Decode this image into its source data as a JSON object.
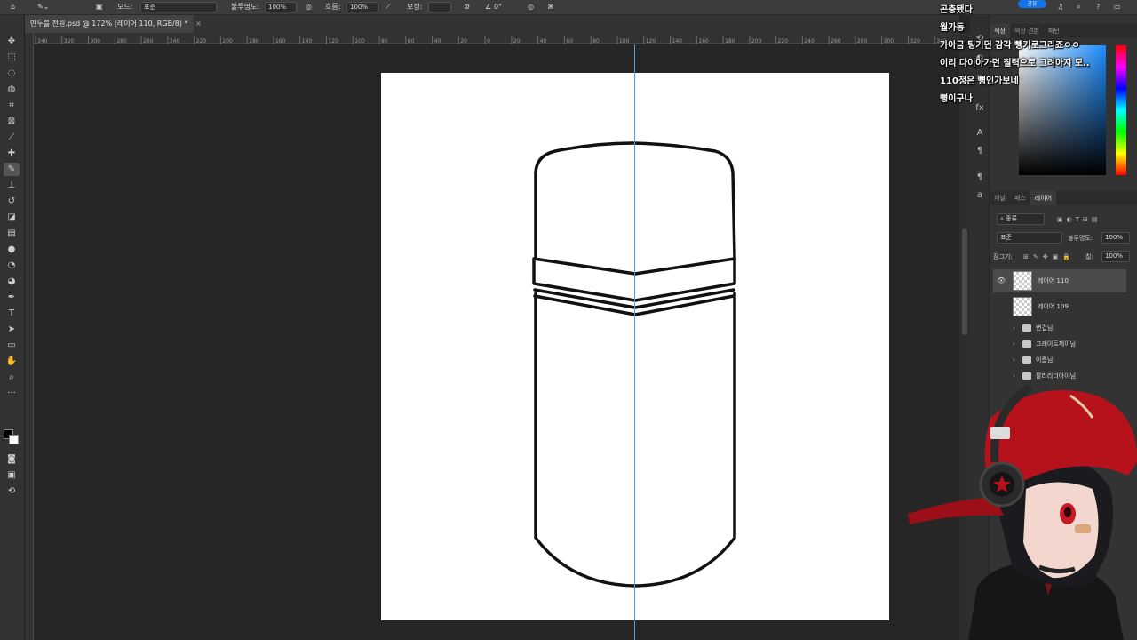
{
  "options_bar": {
    "mode_label": "모드:",
    "mode_value": "표준",
    "opacity_label": "불투명도:",
    "opacity_value": "100%",
    "flow_label": "흐름:",
    "flow_value": "100%",
    "smoothing_label": "보정:",
    "angle_value": "0°",
    "share_label": "공유"
  },
  "document_tab": {
    "title": "만두를 전원.psd @ 172% (레이어 110, RGB/8) *",
    "close": "×"
  },
  "ruler_ticks": [
    "340",
    "320",
    "300",
    "280",
    "260",
    "240",
    "220",
    "200",
    "180",
    "160",
    "140",
    "120",
    "100",
    "80",
    "60",
    "40",
    "20",
    "0",
    "20",
    "40",
    "60",
    "80",
    "100",
    "120",
    "140",
    "160",
    "180",
    "200",
    "220",
    "240",
    "260",
    "280",
    "300",
    "320",
    "340"
  ],
  "color_panel": {
    "tabs": [
      "색상",
      "색상 견본",
      "패턴"
    ]
  },
  "layers_panel": {
    "tabs": [
      "채널",
      "패스",
      "레이어"
    ],
    "filter_label": "종류",
    "blend_mode": "표준",
    "opacity_label": "불투명도:",
    "opacity_value": "100%",
    "lock_label": "잠그기:",
    "fill_label": "칠:",
    "fill_value": "100%",
    "layers": [
      {
        "name": "레이어 110",
        "selected": true,
        "visible": true
      },
      {
        "name": "레이어 109",
        "selected": false,
        "visible": false
      }
    ],
    "groups": [
      {
        "name": "변겁님"
      },
      {
        "name": "그레이트제이님"
      },
      {
        "name": "이름님"
      },
      {
        "name": "팔라리더아야님"
      }
    ]
  },
  "chat": {
    "messages": [
      "곤충됐다",
      "월가동",
      "가아금 팅기던 감각 뺑키로그리죠ㅇㅇ",
      "이리 다이아가던 칠력으로 그려아지 모..",
      "110정은 뼝인가보네",
      "뼝이구나"
    ]
  },
  "colors": {
    "app_bg": "#262626",
    "panel_bg": "#333333",
    "guide": "#4aa3df",
    "accent": "#1473e6",
    "avatar_cap": "#b5121b"
  },
  "icons": [
    "home-icon",
    "brush-icon",
    "move-icon",
    "marquee-icon",
    "lasso-icon",
    "crop-icon",
    "eyedropper-icon",
    "type-icon",
    "hand-icon",
    "zoom-icon",
    "eye-icon",
    "folder-icon",
    "search-icon",
    "bell-icon",
    "help-icon"
  ]
}
